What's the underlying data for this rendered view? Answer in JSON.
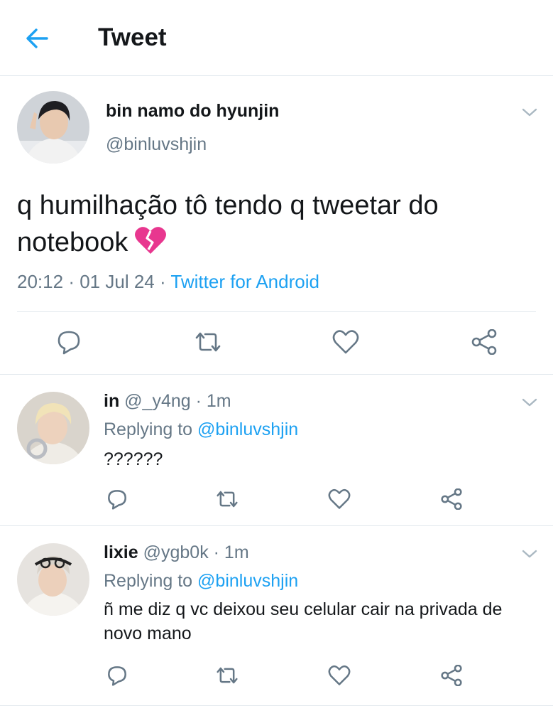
{
  "header": {
    "title": "Tweet",
    "back_icon": "arrow-left-icon"
  },
  "main_tweet": {
    "display_name": "bin namo do hyunjin",
    "handle": "@binluvshjin",
    "text": "q humilhação tô tendo q tweetar do notebook",
    "emoji": "broken-heart-icon",
    "time": "20:12",
    "date": "01 Jul 24",
    "separator": "·",
    "source": "Twitter for Android"
  },
  "replies": [
    {
      "display_name": "in",
      "handle": "@_y4ng",
      "time": "· 1m",
      "replying_prefix": "Replying to ",
      "replying_to": "@binluvshjin",
      "text": "??????"
    },
    {
      "display_name": "lixie",
      "handle": "@ygb0k",
      "time": "· 1m",
      "replying_prefix": "Replying to ",
      "replying_to": "@binluvshjin",
      "text": "ñ me diz q vc deixou seu celular cair na privada de novo mano"
    }
  ],
  "colors": {
    "accent": "#1da1f2",
    "secondary_text": "#657786",
    "border": "#e1e8ed",
    "icon": "#657786"
  }
}
